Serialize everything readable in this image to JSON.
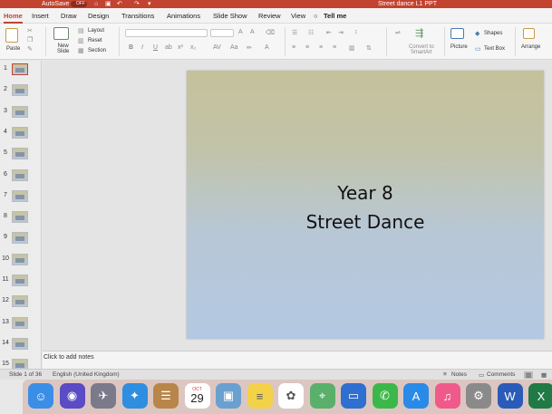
{
  "titlebar": {
    "autosave_label": "AutoSave",
    "autosave_state": "OFF",
    "document_title": "Street dance L1 PPT"
  },
  "tabs": [
    "Home",
    "Insert",
    "Draw",
    "Design",
    "Transitions",
    "Animations",
    "Slide Show",
    "Review",
    "View",
    "Tell me"
  ],
  "ribbon": {
    "paste": "Paste",
    "new_slide": "New\nSlide",
    "layout": "Layout",
    "reset": "Reset",
    "section": "Section",
    "convert_smartart": "Convert to\nSmartArt",
    "picture": "Picture",
    "shapes": "Shapes",
    "text_box": "Text Box",
    "arrange": "Arrange"
  },
  "thumbnails": [
    "1",
    "2",
    "3",
    "4",
    "5",
    "6",
    "7",
    "8",
    "9",
    "10",
    "11",
    "12",
    "13",
    "14",
    "15"
  ],
  "slide": {
    "line1": "Year 8",
    "line2": "Street Dance"
  },
  "notes_placeholder": "Click to add notes",
  "status": {
    "slide_count": "Slide 1 of 36",
    "language": "English (United Kingdom)",
    "notes": "Notes",
    "comments": "Comments"
  },
  "dock_apps": [
    "finder-icon",
    "siri-icon",
    "launchpad-icon",
    "safari-icon",
    "contacts-icon",
    "calendar-icon",
    "preview-icon",
    "notes-icon",
    "photos-icon",
    "maps-icon",
    "keynote-icon",
    "facetime-icon",
    "app-store-icon",
    "itunes-icon",
    "system-preferences-icon",
    "word-icon",
    "excel-icon"
  ],
  "calendar_date": "29",
  "calendar_month": "OCT",
  "colors": {
    "accent": "#c2432f"
  }
}
